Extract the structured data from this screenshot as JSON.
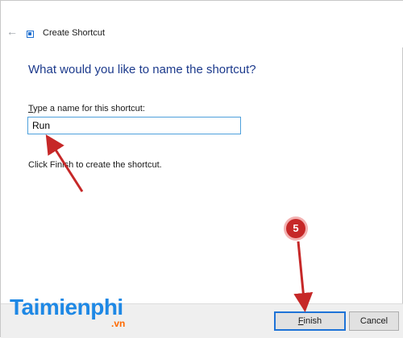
{
  "window": {
    "title": "Create Shortcut"
  },
  "icons": {
    "back": "back-arrow-icon",
    "app": "shortcut-icon"
  },
  "wizard": {
    "heading": "What would you like to name the shortcut?",
    "field_label_accel": "T",
    "field_label_rest": "ype a name for this shortcut:",
    "field_value": "Run",
    "hint": "Click Finish to create the shortcut."
  },
  "footer": {
    "finish_accel": "F",
    "finish_rest": "inish",
    "cancel_label": "Cancel"
  },
  "annotation": {
    "step_number": "5",
    "accent_color": "#c62828"
  },
  "watermark": {
    "brand": "Taimienphi",
    "suffix": ".vn"
  },
  "colors": {
    "heading": "#1c3a8c",
    "input_border": "#4ea0dc",
    "default_button_border": "#1e73d7",
    "brand_blue": "#1e88e5",
    "brand_orange": "#ff6a00"
  }
}
